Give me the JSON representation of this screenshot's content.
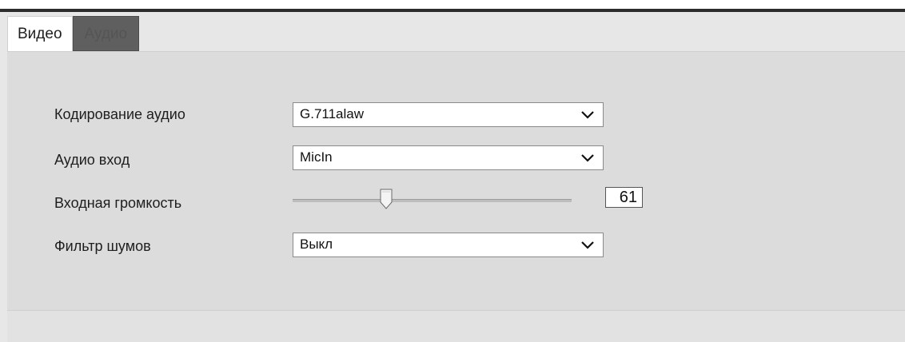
{
  "tabs": [
    {
      "label": "Видео",
      "active": false
    },
    {
      "label": "Аудио",
      "active": true
    }
  ],
  "form": {
    "audio_encoding": {
      "label": "Кодирование аудио",
      "value": "G.711alaw"
    },
    "audio_input": {
      "label": "Аудио вход",
      "value": "MicIn"
    },
    "input_volume": {
      "label": "Входная громкость",
      "value": "61",
      "level": 0.61
    },
    "noise_filter": {
      "label": "Фильтр шумов",
      "value": "Выкл"
    }
  },
  "icons": {
    "dropdown": "chevron-down-icon",
    "slider_thumb": "slider-thumb-icon"
  },
  "colors": {
    "active_tab": "#5f5f5f",
    "panel": "#dcdcdc",
    "field_bg": "#ffffff"
  }
}
